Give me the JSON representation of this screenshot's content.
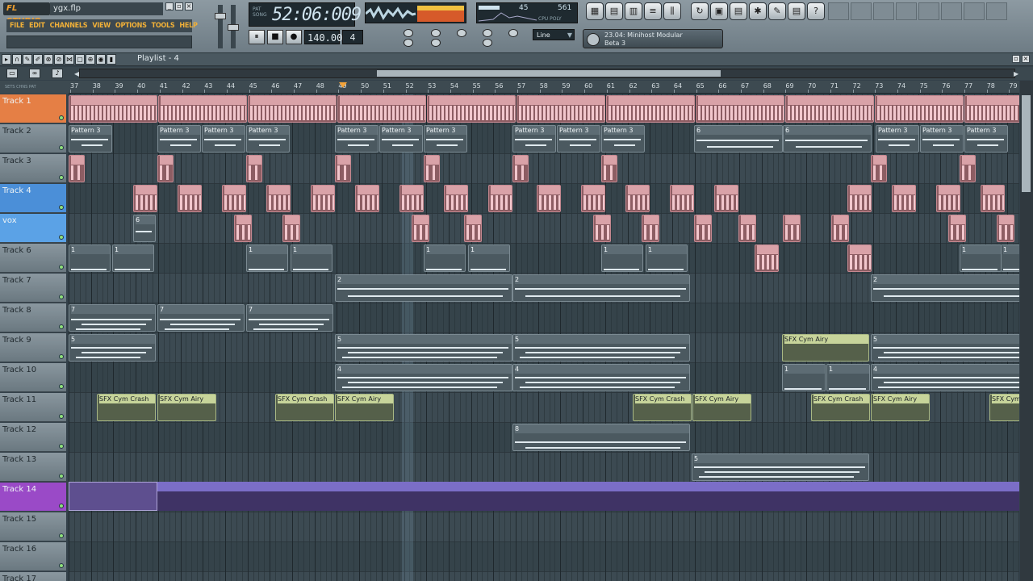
{
  "app": {
    "logo": "FL STUDIO",
    "file_name": "ygx.flp",
    "menu": [
      "FILE",
      "EDIT",
      "CHANNELS",
      "VIEW",
      "OPTIONS",
      "TOOLS",
      "HELP"
    ]
  },
  "transport": {
    "time_label_top": "PAT",
    "time_label_bottom": "SONG",
    "time": "52:06:009",
    "tempo": "140.000",
    "pattern": "4",
    "snap": "Line",
    "cpu": "45",
    "memory": "561",
    "cpu_label": "CPU POLY",
    "buttons": [
      "⏸",
      "■",
      "●"
    ]
  },
  "plugin_hint": {
    "line1": "23.04: Minihost Modular",
    "line2": "Beta 3"
  },
  "playlist": {
    "title": "Playlist - 4",
    "ruler_start": 37,
    "ruler_end": 79
  },
  "tracks": [
    {
      "name": "Track 1",
      "color": "#e57f45"
    },
    {
      "name": "Track 2",
      "color": "#7b8a92"
    },
    {
      "name": "Track 3",
      "color": "#7b8a92"
    },
    {
      "name": "Track 4",
      "color": "#4b8fd8"
    },
    {
      "name": "vox",
      "color": "#5ba2e6"
    },
    {
      "name": "Track 6",
      "color": "#7b8a92"
    },
    {
      "name": "Track 7",
      "color": "#7b8a92"
    },
    {
      "name": "Track 8",
      "color": "#7b8a92"
    },
    {
      "name": "Track 9",
      "color": "#7b8a92"
    },
    {
      "name": "Track 10",
      "color": "#7b8a92"
    },
    {
      "name": "Track 11",
      "color": "#7b8a92"
    },
    {
      "name": "Track 12",
      "color": "#7b8a92"
    },
    {
      "name": "Track 13",
      "color": "#7b8a92"
    },
    {
      "name": "Track 14",
      "color": "#9a4ac7"
    },
    {
      "name": "Track 15",
      "color": "#7b8a92"
    },
    {
      "name": "Track 16",
      "color": "#7b8a92"
    },
    {
      "name": "Track 17",
      "color": "#7b8a92"
    }
  ],
  "clips": {
    "pattern3_label": "Pattern 3",
    "sfx_crash": "SFX Cym Crash",
    "sfx_airy": "SFX Cym Airy",
    "p1": "1",
    "p2": "2",
    "p5": "5",
    "p6": "6",
    "p7": "7",
    "p8": "8",
    "p4": "4"
  },
  "colors": {
    "accent_orange": "#e57f45",
    "track_blue": "#4b8fd8",
    "track_purple": "#9a4ac7",
    "audio_pink": "#d9a2a8",
    "audio_green": "#c7d49a"
  }
}
